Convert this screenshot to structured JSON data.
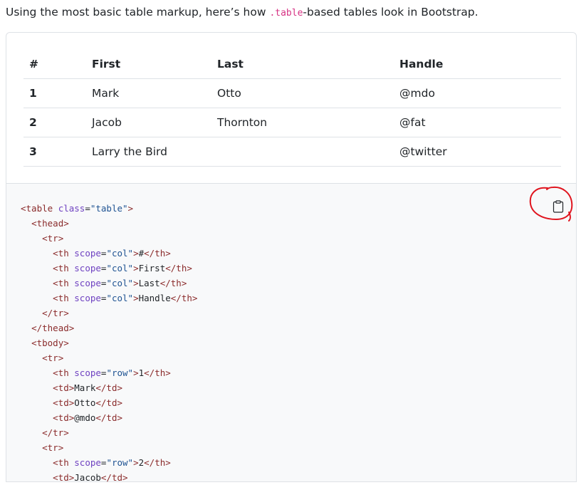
{
  "intro": {
    "before": "Using the most basic table markup, here’s how ",
    "code": ".table",
    "after": "-based tables look in Bootstrap."
  },
  "table": {
    "headers": [
      "#",
      "First",
      "Last",
      "Handle"
    ],
    "rows": [
      [
        "1",
        "Mark",
        "Otto",
        "@mdo"
      ],
      [
        "2",
        "Jacob",
        "Thornton",
        "@fat"
      ],
      [
        "3",
        "Larry the Bird",
        "",
        "@twitter"
      ]
    ]
  },
  "code_lines": [
    "<table class=\"table\">",
    "  <thead>",
    "    <tr>",
    "      <th scope=\"col\">#</th>",
    "      <th scope=\"col\">First</th>",
    "      <th scope=\"col\">Last</th>",
    "      <th scope=\"col\">Handle</th>",
    "    </tr>",
    "  </thead>",
    "  <tbody>",
    "    <tr>",
    "      <th scope=\"row\">1</th>",
    "      <td>Mark</td>",
    "      <td>Otto</td>",
    "      <td>@mdo</td>",
    "    </tr>",
    "    <tr>",
    "      <th scope=\"row\">2</th>",
    "      <td>Jacob</td>"
  ],
  "copy_button": {
    "icon": "clipboard-icon"
  },
  "colors": {
    "code_inline": "#d63384",
    "code_bg": "#f8f9fa",
    "border": "#dee2e6",
    "annotation": "#e0141e"
  }
}
